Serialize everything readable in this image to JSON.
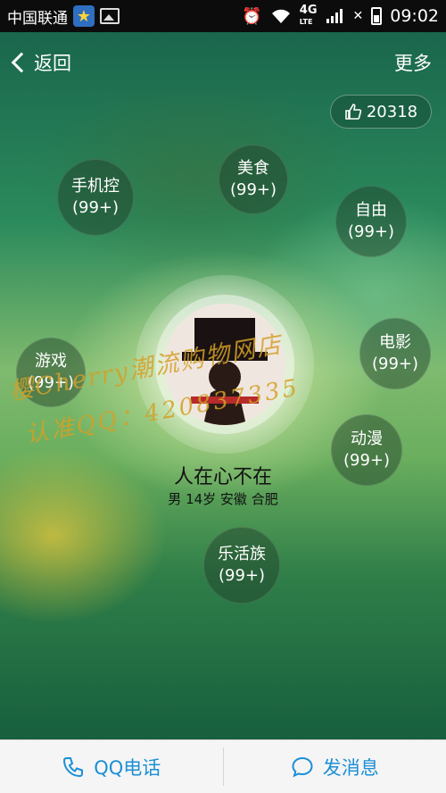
{
  "status_bar": {
    "carrier": "中国联通",
    "net_4g": "4G",
    "net_sub": "LTE",
    "time": "09:02"
  },
  "nav": {
    "back_label": "返回",
    "more_label": "更多"
  },
  "likes": {
    "count": "20318"
  },
  "tags": [
    {
      "name": "手机控",
      "count": "(99+)"
    },
    {
      "name": "美食",
      "count": "(99+)"
    },
    {
      "name": "自由",
      "count": "(99+)"
    },
    {
      "name": "游戏",
      "count": "(99+)"
    },
    {
      "name": "电影",
      "count": "(99+)"
    },
    {
      "name": "动漫",
      "count": "(99+)"
    },
    {
      "name": "乐活族",
      "count": "(99+)"
    }
  ],
  "profile": {
    "nickname": "人在心不在",
    "info": "男 14岁 安徽 合肥"
  },
  "watermark": {
    "line1": "樱Cherry潮流购物网店",
    "line2": "认准QQ：420837335"
  },
  "bottom": {
    "call_label": "QQ电话",
    "message_label": "发消息"
  },
  "colors": {
    "accent": "#1b8fd6",
    "bottom_bar": "#f5f5f5"
  }
}
